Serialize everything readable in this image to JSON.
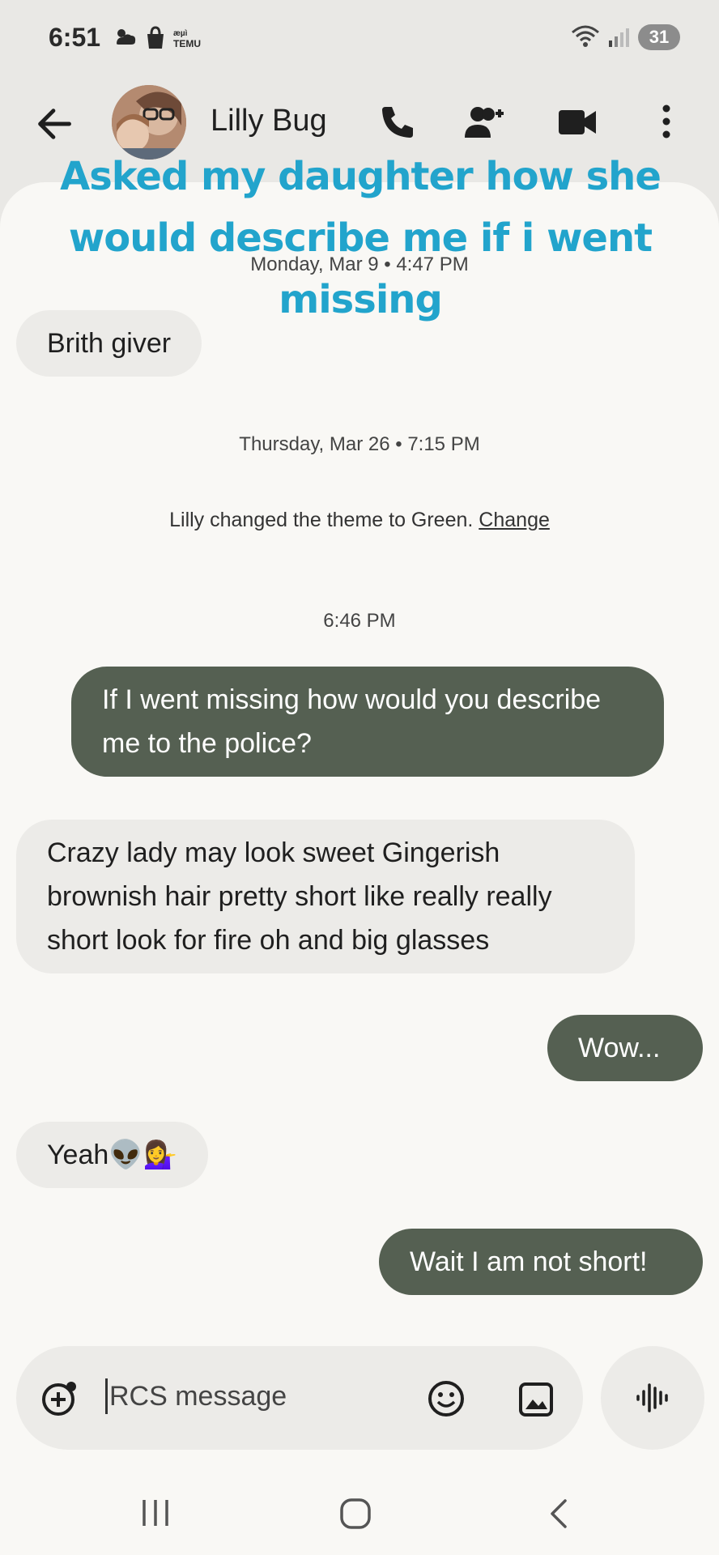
{
  "status": {
    "time": "6:51",
    "battery": "31",
    "temu": "TEMU"
  },
  "contact": {
    "name": "Lilly Bug"
  },
  "caption": "Asked my daughter how she would describe me if i went missing",
  "messages": {
    "date1": "Monday, Mar 9 • 4:47 PM",
    "m1": "Brith giver",
    "date2": "Thursday, Mar 26 • 7:15 PM",
    "system_text": "Lilly changed the theme to Green. ",
    "system_link": "Change",
    "time3": "6:46 PM",
    "m2": "If I went missing how would you describe me to the police?",
    "m3": "Crazy lady may look sweet Gingerish brownish hair pretty short like really really short look for  fire oh and big glasses",
    "m4": "Wow...",
    "m5": "Yeah👽💁‍♀️",
    "m6": "Wait I am not short!"
  },
  "composer": {
    "placeholder": "RCS message"
  },
  "colors": {
    "outgoing": "#556052",
    "incoming": "#ecebe8",
    "caption": "#22a4cc"
  },
  "icons": [
    "back-arrow-icon",
    "phone-icon",
    "add-person-icon",
    "video-icon",
    "more-vert-icon",
    "add-icon",
    "emoji-icon",
    "gallery-icon",
    "voice-icon",
    "recents-icon",
    "home-icon",
    "back-nav-icon"
  ]
}
